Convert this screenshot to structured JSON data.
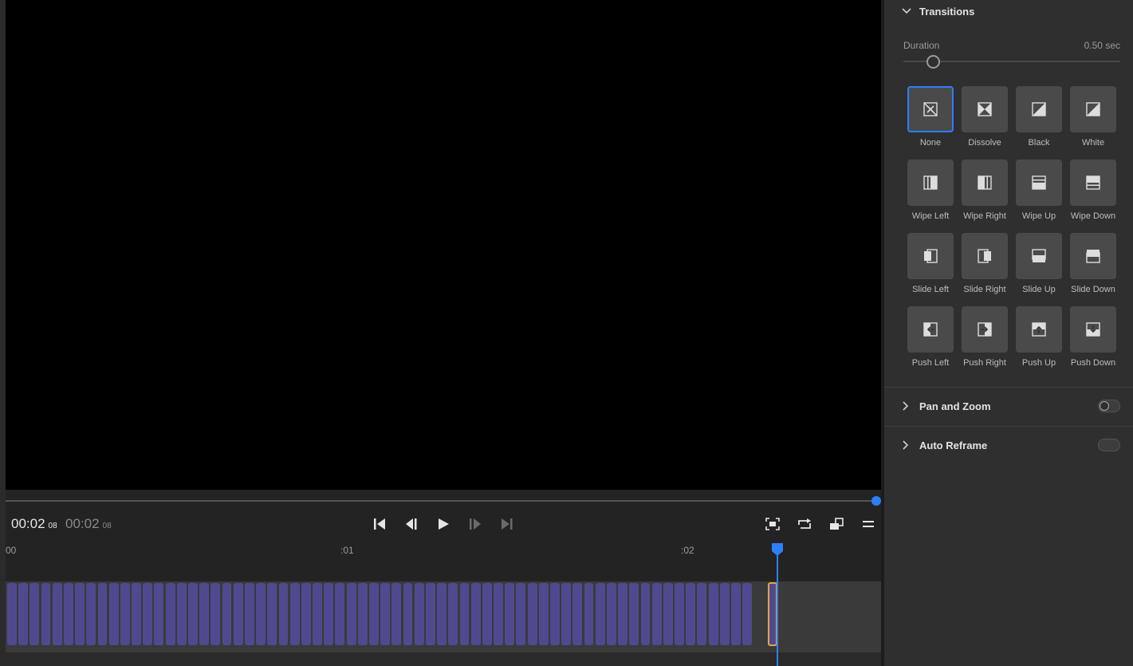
{
  "player": {
    "timecode_current": "00:02",
    "timecode_current_frames": "08",
    "timecode_duration": "00:02",
    "timecode_duration_frames": "08",
    "scrubber_progress": 1.0
  },
  "transport": {
    "go_to_start": "skip-back-icon",
    "step_back": "step-back-icon",
    "play": "play-icon",
    "step_forward": "step-forward-icon",
    "go_to_end": "skip-forward-icon"
  },
  "view_tools": [
    "fit-frame-icon",
    "loop-icon",
    "aspect-icon",
    "menu-icon"
  ],
  "ruler": {
    "labels": [
      "00",
      ":01",
      ":02"
    ]
  },
  "timeline": {
    "frame_count": 66
  },
  "panel": {
    "transitions": {
      "title": "Transitions",
      "duration_label": "Duration",
      "duration_value": "0.50 sec",
      "duration_level": 0.13,
      "selected": "None",
      "items": [
        {
          "label": "None",
          "icon": "none"
        },
        {
          "label": "Dissolve",
          "icon": "dissolve"
        },
        {
          "label": "Black",
          "icon": "black"
        },
        {
          "label": "White",
          "icon": "white"
        },
        {
          "label": "Wipe Left",
          "icon": "wipe-left"
        },
        {
          "label": "Wipe Right",
          "icon": "wipe-right"
        },
        {
          "label": "Wipe Up",
          "icon": "wipe-up"
        },
        {
          "label": "Wipe Down",
          "icon": "wipe-down"
        },
        {
          "label": "Slide Left",
          "icon": "slide-left"
        },
        {
          "label": "Slide Right",
          "icon": "slide-right"
        },
        {
          "label": "Slide Up",
          "icon": "slide-up"
        },
        {
          "label": "Slide Down",
          "icon": "slide-down"
        },
        {
          "label": "Push Left",
          "icon": "push-left"
        },
        {
          "label": "Push Right",
          "icon": "push-right"
        },
        {
          "label": "Push Up",
          "icon": "push-up"
        },
        {
          "label": "Push Down",
          "icon": "push-down"
        }
      ]
    },
    "pan_zoom": {
      "title": "Pan and Zoom",
      "enabled": false
    },
    "auto_reframe": {
      "title": "Auto Reframe",
      "enabled": false
    }
  },
  "colors": {
    "accent": "#2d7ff9",
    "clip": "#4f4a8f",
    "selection": "#e6a24a"
  }
}
